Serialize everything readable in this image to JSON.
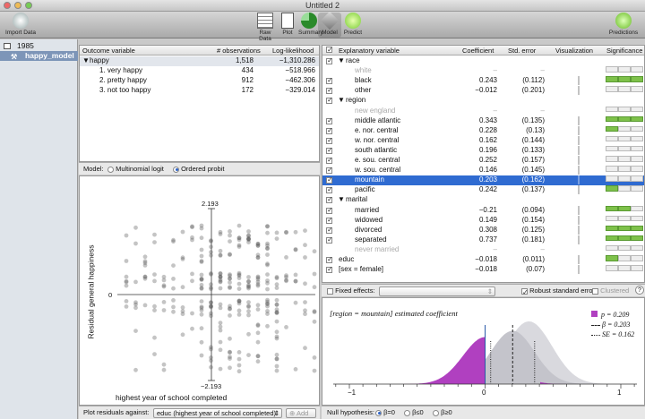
{
  "window": {
    "title": "Untitled 2"
  },
  "toolbar": {
    "items": [
      {
        "label": "Import Data",
        "icon": "import-data-icon"
      },
      {
        "label": "Raw Data",
        "icon": "raw-data-icon"
      },
      {
        "label": "Plot",
        "icon": "plot-icon"
      },
      {
        "label": "Summary",
        "icon": "summary-icon"
      },
      {
        "label": "Model",
        "icon": "model-icon"
      },
      {
        "label": "Predict",
        "icon": "predict-icon"
      },
      {
        "label": "Predictions",
        "icon": "predictions-icon"
      }
    ]
  },
  "sidebar": {
    "dataset": "1985",
    "model": "happy_model"
  },
  "outcome": {
    "headers": [
      "Outcome variable",
      "# observations",
      "Log-likelihood"
    ],
    "rows": [
      {
        "name": "happy",
        "obs": "1,518",
        "ll": "−1,310.286"
      },
      {
        "name": "1. very happy",
        "obs": "434",
        "ll": "−518.966"
      },
      {
        "name": "2. pretty happy",
        "obs": "912",
        "ll": "−462.306"
      },
      {
        "name": "3. not too happy",
        "obs": "172",
        "ll": "−329.014"
      }
    ],
    "model_label": "Model:",
    "model_options": [
      "Multinomial logit",
      "Ordered probit"
    ],
    "model_selected": "Ordered probit"
  },
  "residual_plot": {
    "ylabel": "Residual general happiness",
    "xlabel": "highest year of school completed",
    "y_top": "2.193",
    "y_bottom": "−2.193",
    "x_zero": "0",
    "y_zero": "0",
    "against_label": "Plot residuals against:",
    "against_value": "educ (highest year of school completed)",
    "add_label": "Add"
  },
  "coef_table": {
    "headers": [
      "Explanatory variable",
      "Coefficient",
      "Std. error",
      "Visualization",
      "Significance"
    ],
    "rows": [
      {
        "type": "group",
        "label": "race"
      },
      {
        "type": "base",
        "label": "white",
        "coef": "–",
        "se": "–"
      },
      {
        "type": "var",
        "label": "black",
        "coef": "0.243",
        "se": "(0.112)",
        "sig": [
          1,
          1,
          1
        ]
      },
      {
        "type": "var",
        "label": "other",
        "coef": "−0.012",
        "se": "(0.201)",
        "sig": [
          0,
          0,
          0
        ]
      },
      {
        "type": "group",
        "label": "region"
      },
      {
        "type": "base",
        "label": "new england",
        "coef": "–",
        "se": "–"
      },
      {
        "type": "var",
        "label": "middle atlantic",
        "coef": "0.343",
        "se": "(0.135)",
        "sig": [
          1,
          1,
          1
        ]
      },
      {
        "type": "var",
        "label": "e. nor. central",
        "coef": "0.228",
        "se": "(0.13)",
        "sig": [
          1,
          0,
          0
        ]
      },
      {
        "type": "var",
        "label": "w. nor. central",
        "coef": "0.162",
        "se": "(0.144)",
        "sig": [
          0,
          0,
          0
        ]
      },
      {
        "type": "var",
        "label": "south atlantic",
        "coef": "0.196",
        "se": "(0.133)",
        "sig": [
          0,
          0,
          0
        ]
      },
      {
        "type": "var",
        "label": "e. sou. central",
        "coef": "0.252",
        "se": "(0.157)",
        "sig": [
          0,
          0,
          0
        ]
      },
      {
        "type": "var",
        "label": "w. sou. central",
        "coef": "0.146",
        "se": "(0.145)",
        "sig": [
          0,
          0,
          0
        ]
      },
      {
        "type": "var",
        "label": "mountain",
        "coef": "0.203",
        "se": "(0.162)",
        "sig": [
          0,
          0,
          0
        ],
        "selected": true
      },
      {
        "type": "var",
        "label": "pacific",
        "coef": "0.242",
        "se": "(0.137)",
        "sig": [
          1,
          0,
          0
        ]
      },
      {
        "type": "group",
        "label": "marital"
      },
      {
        "type": "var",
        "label": "married",
        "coef": "−0.21",
        "se": "(0.094)",
        "sig": [
          1,
          1,
          0
        ]
      },
      {
        "type": "var",
        "label": "widowed",
        "coef": "0.149",
        "se": "(0.154)",
        "sig": [
          0,
          0,
          0
        ]
      },
      {
        "type": "var",
        "label": "divorced",
        "coef": "0.308",
        "se": "(0.125)",
        "sig": [
          1,
          1,
          1
        ]
      },
      {
        "type": "var",
        "label": "separated",
        "coef": "0.737",
        "se": "(0.181)",
        "sig": [
          1,
          1,
          1
        ]
      },
      {
        "type": "base",
        "label": "never married",
        "coef": "–",
        "se": "–"
      },
      {
        "type": "var",
        "label": "educ",
        "coef": "−0.018",
        "se": "(0.011)",
        "sig": [
          1,
          0,
          0
        ]
      },
      {
        "type": "var",
        "label": "[sex = female]",
        "coef": "−0.018",
        "se": "(0.07)",
        "sig": [
          0,
          0,
          0
        ]
      }
    ],
    "fixed_effects_label": "Fixed effects:",
    "robust_label": "Robust standard errors",
    "clustered_label": "Clustered"
  },
  "coef_plot": {
    "title": "[region = mountain] estimated coefficient",
    "legend": [
      "p = 0.209",
      "β = 0.203",
      "SE = 0.162"
    ],
    "ticks": [
      "−1",
      "0",
      "1"
    ],
    "beta": 0.203,
    "se": 0.162,
    "null_label": "Null hypothesis:",
    "null_options": [
      "β=0",
      "β≤0",
      "β≥0"
    ],
    "colors": {
      "accent": "#b040c0",
      "selection": "#2f6bd1",
      "good": "#7ec14a"
    }
  }
}
